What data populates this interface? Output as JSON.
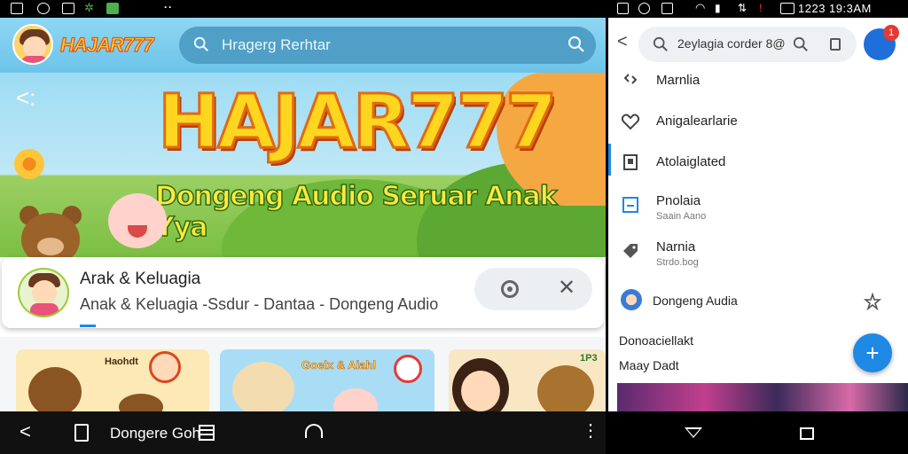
{
  "left_app": {
    "brand": "HAJAR777",
    "search_placeholder": "Hragerg Rerhtar",
    "banner": {
      "title": "HAJAR777",
      "subtitle": "Dongeng Audio Seruar Anak Yya"
    },
    "card": {
      "title": "Arak & Keluagia",
      "subtitle": "Anak & Keluagia -Ssdur - Dantaa - Dongeng Audio"
    },
    "thumbnails": [
      {
        "label": "Haohdt"
      },
      {
        "label": "Goelx & Aiahl"
      },
      {
        "label": "1P3"
      }
    ],
    "bottom_bar": {
      "text": "Dongere Goh"
    }
  },
  "right_app": {
    "status": {
      "time": "1223 19:3AM"
    },
    "search": {
      "text": "2eylagia corder 8@"
    },
    "badge": "1",
    "menu": [
      {
        "label": "Marnlia",
        "sublabel": ""
      },
      {
        "label": "Anigalearlarie",
        "sublabel": ""
      },
      {
        "label": "Atolaiglated",
        "sublabel": ""
      },
      {
        "label": "Pnolaia",
        "sublabel": "Saain Aano"
      },
      {
        "label": "Narnia",
        "sublabel": "Strdo.bog"
      }
    ],
    "playlist": {
      "label": "Dongeng Audia"
    },
    "section_labels": [
      "Donoaciellakt",
      "Maay Dadt"
    ],
    "fab_symbol": "+"
  },
  "colors": {
    "accent": "#1e88e5",
    "brand_yellow": "#ffd61f",
    "header_blue": "#6cc4ea"
  }
}
